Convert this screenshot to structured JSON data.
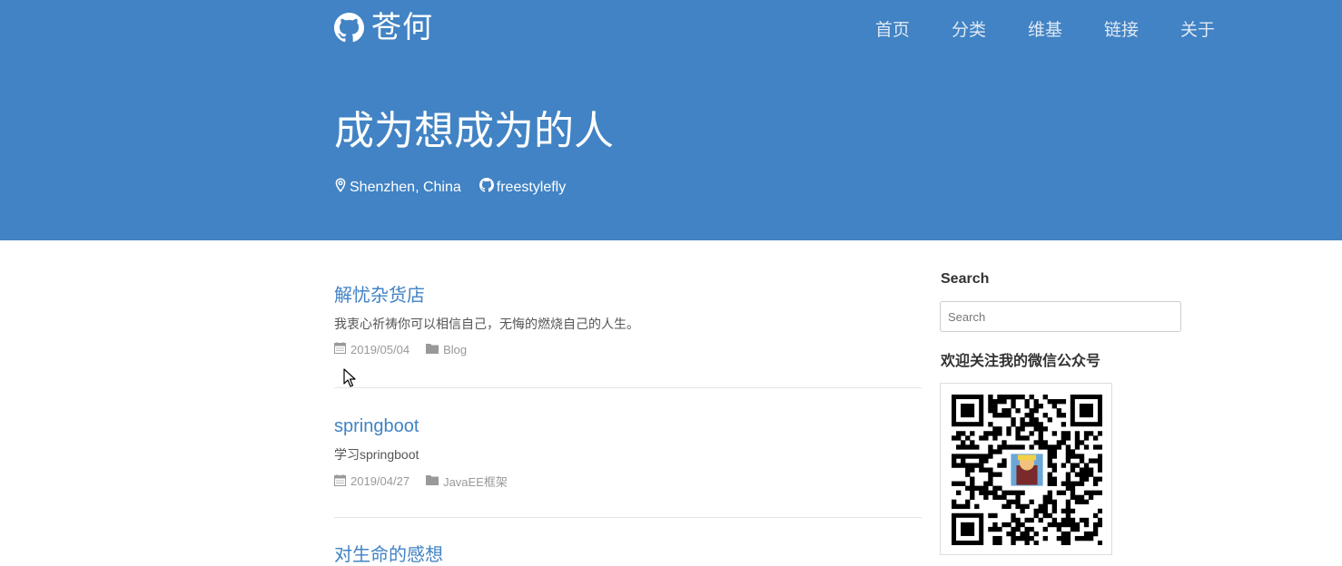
{
  "site": {
    "title": "苍何",
    "nav": [
      "首页",
      "分类",
      "维基",
      "链接",
      "关于"
    ]
  },
  "hero": {
    "title": "成为想成为的人",
    "location": "Shenzhen, China",
    "github": "freestylefly"
  },
  "posts": [
    {
      "title": "解忧杂货店",
      "excerpt": "我衷心祈祷你可以相信自己，无悔的燃烧自己的人生。",
      "date": "2019/05/04",
      "category": "Blog"
    },
    {
      "title": "springboot",
      "excerpt": "学习springboot",
      "date": "2019/04/27",
      "category": "JavaEE框架"
    },
    {
      "title": "对生命的感想"
    }
  ],
  "sidebar": {
    "search_heading": "Search",
    "search_placeholder": "Search",
    "wechat_heading": "欢迎关注我的微信公众号"
  },
  "colors": {
    "header_bg": "#4183c4",
    "link": "#4183c4",
    "meta": "#999999"
  }
}
